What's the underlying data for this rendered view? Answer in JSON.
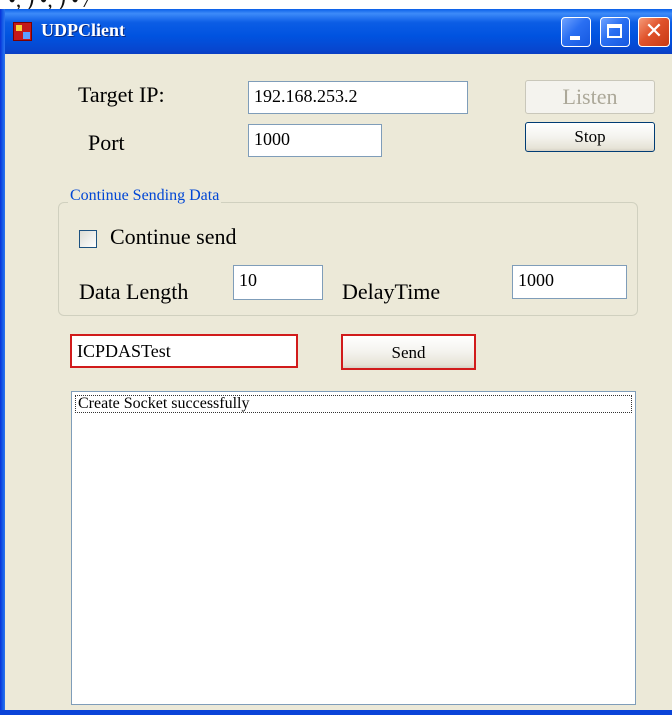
{
  "crop_residue": "•, ) •, ) • /",
  "window": {
    "title": "UDPClient",
    "minimize_glyph": "",
    "maximize_glyph": "",
    "close_glyph": "✕",
    "icons": [
      "app-icon",
      "minimize-icon",
      "maximize-icon",
      "close-icon"
    ]
  },
  "connection": {
    "target_ip_label": "Target IP:",
    "target_ip_value": "192.168.253.2",
    "port_label": "Port",
    "port_value": "1000",
    "listen_label": "Listen",
    "stop_label": "Stop"
  },
  "continuous": {
    "group_title": "Continue Sending Data",
    "checkbox_label": "Continue send",
    "checkbox_checked": false,
    "data_length_label": "Data Length",
    "data_length_value": "10",
    "delay_time_label": "DelayTime",
    "delay_time_value": "1000"
  },
  "send": {
    "message_value": "ICPDASTest",
    "send_label": "Send"
  },
  "log": {
    "items": [
      "Create Socket successfully"
    ]
  },
  "colors": {
    "titlebar": "#0054e3",
    "window_bg": "#ece9d8",
    "highlight_red": "#d11b1b",
    "group_title": "#0046d5"
  }
}
